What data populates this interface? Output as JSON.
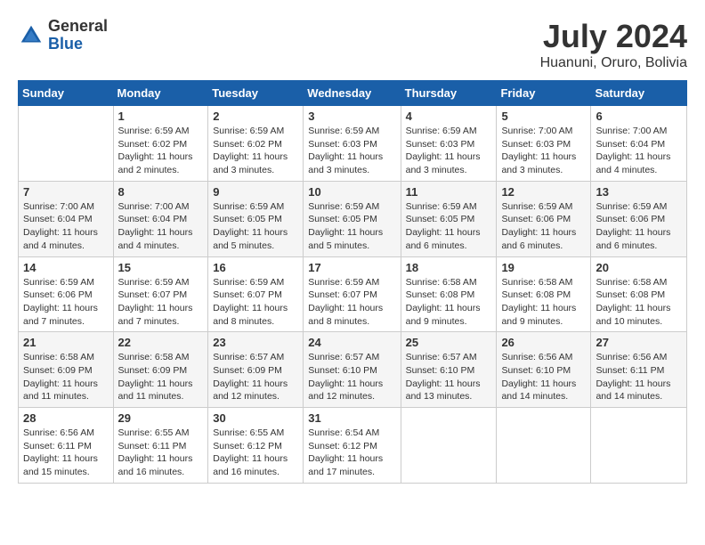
{
  "header": {
    "logo_general": "General",
    "logo_blue": "Blue",
    "month_title": "July 2024",
    "location": "Huanuni, Oruro, Bolivia"
  },
  "calendar": {
    "weekdays": [
      "Sunday",
      "Monday",
      "Tuesday",
      "Wednesday",
      "Thursday",
      "Friday",
      "Saturday"
    ],
    "weeks": [
      [
        {
          "day": "",
          "info": ""
        },
        {
          "day": "1",
          "info": "Sunrise: 6:59 AM\nSunset: 6:02 PM\nDaylight: 11 hours\nand 2 minutes."
        },
        {
          "day": "2",
          "info": "Sunrise: 6:59 AM\nSunset: 6:02 PM\nDaylight: 11 hours\nand 3 minutes."
        },
        {
          "day": "3",
          "info": "Sunrise: 6:59 AM\nSunset: 6:03 PM\nDaylight: 11 hours\nand 3 minutes."
        },
        {
          "day": "4",
          "info": "Sunrise: 6:59 AM\nSunset: 6:03 PM\nDaylight: 11 hours\nand 3 minutes."
        },
        {
          "day": "5",
          "info": "Sunrise: 7:00 AM\nSunset: 6:03 PM\nDaylight: 11 hours\nand 3 minutes."
        },
        {
          "day": "6",
          "info": "Sunrise: 7:00 AM\nSunset: 6:04 PM\nDaylight: 11 hours\nand 4 minutes."
        }
      ],
      [
        {
          "day": "7",
          "info": "Sunrise: 7:00 AM\nSunset: 6:04 PM\nDaylight: 11 hours\nand 4 minutes."
        },
        {
          "day": "8",
          "info": "Sunrise: 7:00 AM\nSunset: 6:04 PM\nDaylight: 11 hours\nand 4 minutes."
        },
        {
          "day": "9",
          "info": "Sunrise: 6:59 AM\nSunset: 6:05 PM\nDaylight: 11 hours\nand 5 minutes."
        },
        {
          "day": "10",
          "info": "Sunrise: 6:59 AM\nSunset: 6:05 PM\nDaylight: 11 hours\nand 5 minutes."
        },
        {
          "day": "11",
          "info": "Sunrise: 6:59 AM\nSunset: 6:05 PM\nDaylight: 11 hours\nand 6 minutes."
        },
        {
          "day": "12",
          "info": "Sunrise: 6:59 AM\nSunset: 6:06 PM\nDaylight: 11 hours\nand 6 minutes."
        },
        {
          "day": "13",
          "info": "Sunrise: 6:59 AM\nSunset: 6:06 PM\nDaylight: 11 hours\nand 6 minutes."
        }
      ],
      [
        {
          "day": "14",
          "info": "Sunrise: 6:59 AM\nSunset: 6:06 PM\nDaylight: 11 hours\nand 7 minutes."
        },
        {
          "day": "15",
          "info": "Sunrise: 6:59 AM\nSunset: 6:07 PM\nDaylight: 11 hours\nand 7 minutes."
        },
        {
          "day": "16",
          "info": "Sunrise: 6:59 AM\nSunset: 6:07 PM\nDaylight: 11 hours\nand 8 minutes."
        },
        {
          "day": "17",
          "info": "Sunrise: 6:59 AM\nSunset: 6:07 PM\nDaylight: 11 hours\nand 8 minutes."
        },
        {
          "day": "18",
          "info": "Sunrise: 6:58 AM\nSunset: 6:08 PM\nDaylight: 11 hours\nand 9 minutes."
        },
        {
          "day": "19",
          "info": "Sunrise: 6:58 AM\nSunset: 6:08 PM\nDaylight: 11 hours\nand 9 minutes."
        },
        {
          "day": "20",
          "info": "Sunrise: 6:58 AM\nSunset: 6:08 PM\nDaylight: 11 hours\nand 10 minutes."
        }
      ],
      [
        {
          "day": "21",
          "info": "Sunrise: 6:58 AM\nSunset: 6:09 PM\nDaylight: 11 hours\nand 11 minutes."
        },
        {
          "day": "22",
          "info": "Sunrise: 6:58 AM\nSunset: 6:09 PM\nDaylight: 11 hours\nand 11 minutes."
        },
        {
          "day": "23",
          "info": "Sunrise: 6:57 AM\nSunset: 6:09 PM\nDaylight: 11 hours\nand 12 minutes."
        },
        {
          "day": "24",
          "info": "Sunrise: 6:57 AM\nSunset: 6:10 PM\nDaylight: 11 hours\nand 12 minutes."
        },
        {
          "day": "25",
          "info": "Sunrise: 6:57 AM\nSunset: 6:10 PM\nDaylight: 11 hours\nand 13 minutes."
        },
        {
          "day": "26",
          "info": "Sunrise: 6:56 AM\nSunset: 6:10 PM\nDaylight: 11 hours\nand 14 minutes."
        },
        {
          "day": "27",
          "info": "Sunrise: 6:56 AM\nSunset: 6:11 PM\nDaylight: 11 hours\nand 14 minutes."
        }
      ],
      [
        {
          "day": "28",
          "info": "Sunrise: 6:56 AM\nSunset: 6:11 PM\nDaylight: 11 hours\nand 15 minutes."
        },
        {
          "day": "29",
          "info": "Sunrise: 6:55 AM\nSunset: 6:11 PM\nDaylight: 11 hours\nand 16 minutes."
        },
        {
          "day": "30",
          "info": "Sunrise: 6:55 AM\nSunset: 6:12 PM\nDaylight: 11 hours\nand 16 minutes."
        },
        {
          "day": "31",
          "info": "Sunrise: 6:54 AM\nSunset: 6:12 PM\nDaylight: 11 hours\nand 17 minutes."
        },
        {
          "day": "",
          "info": ""
        },
        {
          "day": "",
          "info": ""
        },
        {
          "day": "",
          "info": ""
        }
      ]
    ]
  }
}
